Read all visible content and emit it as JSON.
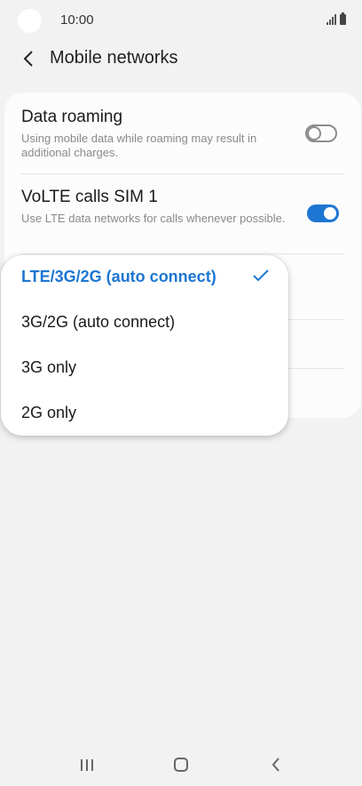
{
  "status_bar": {
    "time": "10:00"
  },
  "header": {
    "title": "Mobile networks",
    "back_icon": "chevron-left-icon"
  },
  "settings": [
    {
      "title": "Data roaming",
      "description": "Using mobile data while roaming may result in additional charges.",
      "toggle_on": false
    },
    {
      "title": "VoLTE calls SIM 1",
      "description": "Use LTE data networks for calls whenever possible.",
      "toggle_on": true
    }
  ],
  "network_mode_menu": {
    "options": [
      {
        "label": "LTE/3G/2G (auto connect)",
        "selected": true
      },
      {
        "label": "3G/2G (auto connect)",
        "selected": false
      },
      {
        "label": "3G only",
        "selected": false
      },
      {
        "label": "2G only",
        "selected": false
      }
    ]
  },
  "nav_bar": {
    "recents_icon": "recents-icon",
    "home_icon": "home-icon",
    "back_icon": "back-icon"
  },
  "colors": {
    "accent": "#1d76d2",
    "background": "#f2f2f2",
    "card": "#fcfcfc"
  }
}
